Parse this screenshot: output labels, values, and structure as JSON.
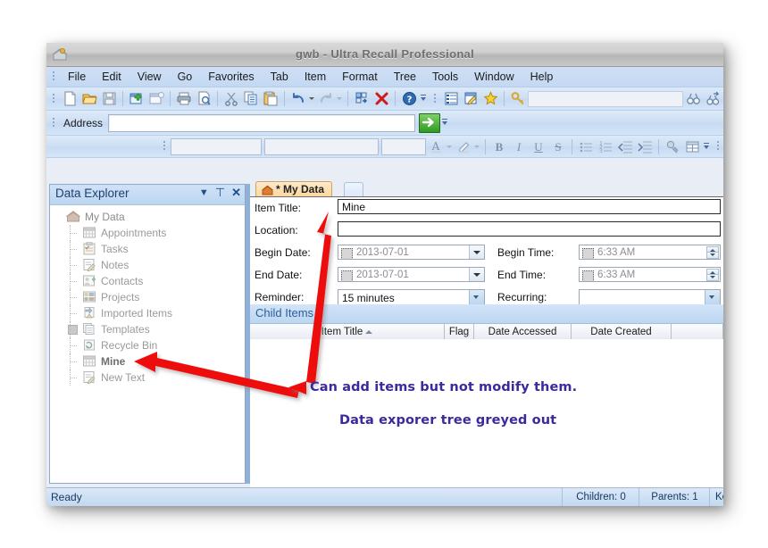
{
  "window": {
    "title": "gwb  -  Ultra Recall Professional",
    "app_icon": "ultra-recall-icon"
  },
  "menubar": {
    "items": [
      "File",
      "Edit",
      "View",
      "Go",
      "Favorites",
      "Tab",
      "Item",
      "Format",
      "Tree",
      "Tools",
      "Window",
      "Help"
    ]
  },
  "toolbar_main": {
    "icons": [
      "new-document-icon",
      "open-folder-icon",
      "save-disk-icon",
      "new-item-icon",
      "new-child-item-icon",
      "print-icon",
      "print-preview-icon",
      "cut-scissors-icon",
      "copy-icon",
      "paste-icon",
      "undo-icon",
      "redo-icon",
      "arrange-icon",
      "delete-x-icon",
      "help-question-icon"
    ],
    "search_icons": [
      "list-view-icon",
      "edit-note-icon",
      "favorites-star-icon",
      "search-key-icon"
    ],
    "search_value": "",
    "find_icons": [
      "find-binoculars-icon",
      "find-next-binoculars-icon",
      "back-navigate-icon"
    ]
  },
  "address_bar": {
    "label": "Address",
    "value": "",
    "go_button": "go-arrow-icon"
  },
  "format_toolbar": {
    "font_family": "",
    "font_style": "",
    "font_size": "",
    "icons": [
      "font-color-icon",
      "highlight-color-icon",
      "bold-icon",
      "italic-icon",
      "underline-icon",
      "strikethrough-icon",
      "bullet-list-icon",
      "numbered-list-icon",
      "decrease-indent-icon",
      "increase-indent-icon",
      "hyperlink-icon",
      "insert-table-icon"
    ],
    "bold_label": "B",
    "italic_label": "I",
    "underline_label": "U",
    "strike_label": "S",
    "font_a_label": "A"
  },
  "explorer": {
    "title": "Data Explorer",
    "header_buttons": [
      "dropdown-chevron-icon",
      "pin-icon",
      "close-icon"
    ],
    "tree": [
      {
        "label": "My Data",
        "icon": "home-house-icon",
        "level": 0,
        "bold": false,
        "expander": "none"
      },
      {
        "label": "Appointments",
        "icon": "calendar-icon",
        "level": 1,
        "bold": false,
        "expander": "dash"
      },
      {
        "label": "Tasks",
        "icon": "clipboard-task-icon",
        "level": 1,
        "bold": false,
        "expander": "dash"
      },
      {
        "label": "Notes",
        "icon": "note-pencil-icon",
        "level": 1,
        "bold": false,
        "expander": "dash"
      },
      {
        "label": "Contacts",
        "icon": "contact-card-icon",
        "level": 1,
        "bold": false,
        "expander": "dash"
      },
      {
        "label": "Projects",
        "icon": "projects-grid-icon",
        "level": 1,
        "bold": false,
        "expander": "dash"
      },
      {
        "label": "Imported Items",
        "icon": "imported-items-icon",
        "level": 1,
        "bold": false,
        "expander": "dash"
      },
      {
        "label": "Templates",
        "icon": "templates-stack-icon",
        "level": 1,
        "bold": false,
        "expander": "plus"
      },
      {
        "label": "Recycle Bin",
        "icon": "recycle-bin-icon",
        "level": 1,
        "bold": false,
        "expander": "dash"
      },
      {
        "label": "Mine",
        "icon": "calendar-icon",
        "level": 1,
        "bold": true,
        "expander": "dash"
      },
      {
        "label": "New Text",
        "icon": "note-pencil-icon",
        "level": 1,
        "bold": false,
        "expander": "dash"
      }
    ]
  },
  "tab_strip": {
    "active_tab": "* My Data",
    "tab_icon": "home-house-icon"
  },
  "item_form": {
    "fields": [
      {
        "label": "Item Title:",
        "value": "Mine"
      },
      {
        "label": "Location:",
        "value": ""
      }
    ],
    "begin_date": {
      "label": "Begin Date:",
      "value": "2013-07-01"
    },
    "begin_time": {
      "label": "Begin Time:",
      "value": "6:33 AM"
    },
    "end_date": {
      "label": "End Date:",
      "value": "2013-07-01"
    },
    "end_time": {
      "label": "End Time:",
      "value": "6:33 AM"
    },
    "reminder": {
      "label": "Reminder:",
      "value": "15 minutes"
    },
    "recurring": {
      "label": "Recurring:",
      "value": ""
    }
  },
  "child_items": {
    "title": "Child Items",
    "columns": [
      "Item Title",
      "Flag",
      "Date Accessed",
      "Date Created",
      ""
    ],
    "sort_column": "Item Title",
    "sort_direction": "ascending",
    "rows": []
  },
  "status_bar": {
    "message": "Ready",
    "children": "Children: 0",
    "parents": "Parents: 1",
    "keywords": "Keyw"
  },
  "annotations": {
    "line1": "Can add items but not modify them.",
    "line2": "Data exporer tree greyed out",
    "color": "#3b2a9c",
    "arrow_color": "#ee1111"
  }
}
